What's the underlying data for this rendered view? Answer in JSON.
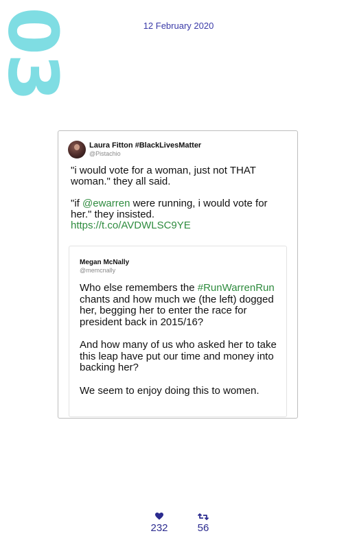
{
  "page_number": "03",
  "date": "12 February 2020",
  "tweet": {
    "author": {
      "display_name": "Laura Fitton #BlackLivesMatter",
      "handle": "@Pistachio"
    },
    "text": {
      "p1": "\"i would vote for a woman, just not THAT woman.\" they all said.",
      "p2_before": "\"if ",
      "p2_mention": "@ewarren",
      "p2_after": " were running, i would vote for her.\" they insisted.",
      "link": "https://t.co/AVDWLSC9YE"
    }
  },
  "quoted_tweet": {
    "display_name": "Megan McNally",
    "handle": "@memcnally",
    "p1_before": "Who else remembers the ",
    "p1_hashtag": "#RunWarrenRun",
    "p1_after": " chants and how much we (the left) dogged her, begging her to enter the race for president back in 2015/16?",
    "p2": "And how many of us who asked her to take this leap have put our time and money into backing her?",
    "p3": "We seem to enjoy doing this to women."
  },
  "stats": {
    "likes_icon": "heart-icon",
    "likes": "232",
    "retweets_icon": "retweet-icon",
    "retweets": "56"
  },
  "colors": {
    "accent": "#2e8b3e",
    "page_number": "#7fdde3",
    "date": "#3a3aa8",
    "stats": "#2b2b8f"
  }
}
